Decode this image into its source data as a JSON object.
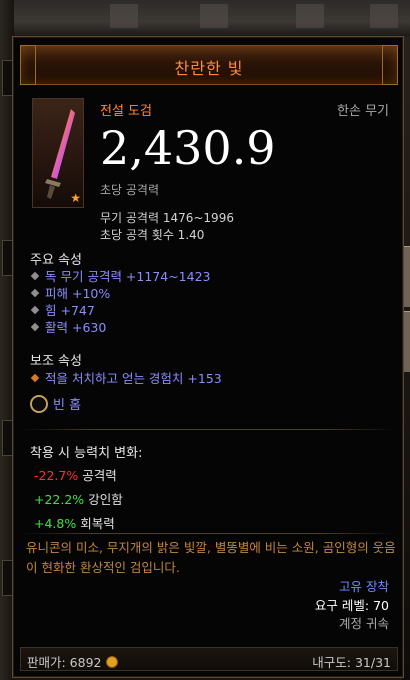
{
  "item": {
    "name": "찬란한 빛",
    "rarity": "전설 도검",
    "slot": "한손 무기",
    "dps": "2,430.9",
    "dps_label": "초당 공격력",
    "damage_line": "무기 공격력 1476~1996",
    "speed_line": "초당 공격 횟수 1.40"
  },
  "primary": {
    "title": "주요 속성",
    "props": [
      "독 무기 공격력 +1174~1423",
      "피해 +10%",
      "힘 +747",
      "활력 +630"
    ]
  },
  "secondary": {
    "title": "보조 속성",
    "props": [
      "적을 처치하고 얻는 경험치 +153"
    ]
  },
  "socket_label": "빈 홈",
  "changes": {
    "title": "착용 시 능력치 변화:",
    "rows": [
      {
        "value": "-22.7%",
        "label": "공격력",
        "sign": "neg"
      },
      {
        "value": "+22.2%",
        "label": "강인함",
        "sign": "pos"
      },
      {
        "value": "+4.8%",
        "label": "회복력",
        "sign": "pos"
      }
    ]
  },
  "flavor": "유니콘의 미소, 무지개의 밝은 빛깔, 별똥별에 비는 소원, 곰인형의 웃음이 현화한 환상적인 검입니다.",
  "legendary_label": "고유 장착",
  "required_level": "요구 레벨: 70",
  "bind": "계정 귀속",
  "sell_price": "판매가: 6892",
  "durability": "내구도: 31/31",
  "colors": {
    "legendary_orange": "#ff8a3a",
    "magic_blue": "#8c8cff",
    "negative": "#ff3030",
    "positive": "#40e040"
  }
}
